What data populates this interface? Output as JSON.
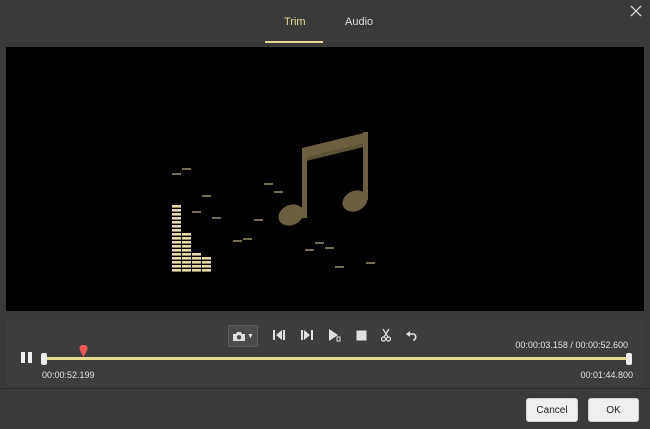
{
  "tabs": [
    {
      "label": "Trim",
      "active": true
    },
    {
      "label": "Audio",
      "active": false
    }
  ],
  "window": {
    "close_icon": "close-icon"
  },
  "preview": {
    "artwork_icon": "music-note-equalizer-icon"
  },
  "toolbar": {
    "icons": [
      "camera-snapshot-icon",
      "previous-frame-icon",
      "next-frame-icon",
      "play-segment-icon",
      "stop-icon",
      "scissors-icon",
      "undo-icon"
    ]
  },
  "playback": {
    "current_time": "00:00:03.158",
    "separator": "/",
    "total_time": "00:00:52.600",
    "current_time_fraction": 0.06
  },
  "trim": {
    "start_time": "00:00:52.199",
    "end_time": "00:01:44.800"
  },
  "colors": {
    "accent": "#e9d896",
    "marker": "#e85a57"
  },
  "buttons": {
    "cancel_label": "Cancel",
    "ok_label": "OK"
  }
}
